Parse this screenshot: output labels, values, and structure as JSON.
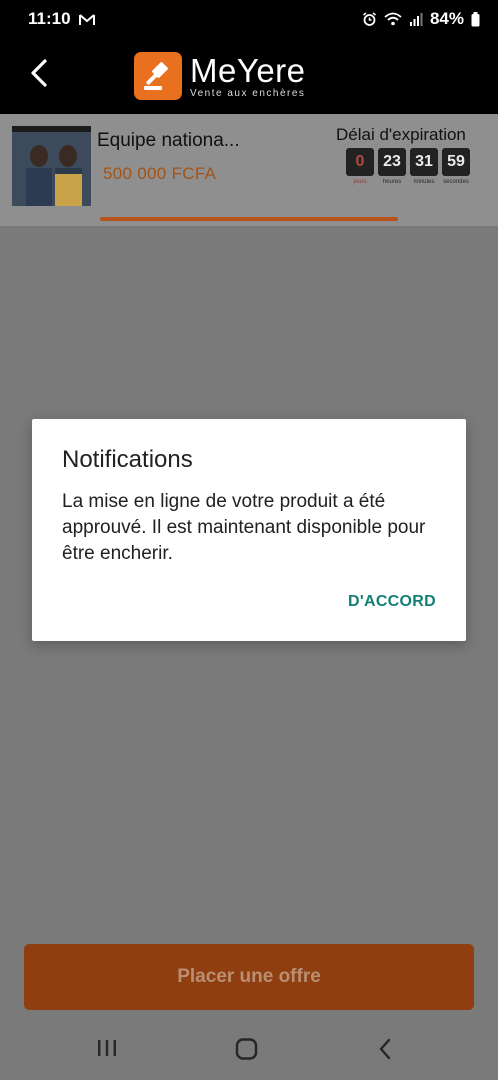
{
  "status_bar": {
    "time": "11:10",
    "battery": "84%"
  },
  "header": {
    "app_name": "MeYere",
    "tagline": "Vente aux enchères"
  },
  "product": {
    "title": "Equipe nationa...",
    "price": "500 000 FCFA",
    "expiry_label": "Délai d'expiration",
    "countdown": {
      "days": "0",
      "days_label": "jours",
      "hours": "23",
      "hours_label": "heures",
      "minutes": "31",
      "minutes_label": "minutes",
      "seconds": "59",
      "seconds_label": "secondes"
    }
  },
  "dialog": {
    "title": "Notifications",
    "message": "La mise en ligne de votre produit a été approuvé. Il est maintenant disponible pour être encherir.",
    "ok_label": "D'ACCORD"
  },
  "footer": {
    "place_offer_label": "Placer une offre"
  },
  "icons": {
    "back": "chevron-left-icon",
    "logo": "gavel-icon",
    "nav_recent": "recent-apps-icon",
    "nav_home": "home-icon",
    "nav_back": "nav-back-icon"
  },
  "colors": {
    "accent": "#e8701f",
    "dialog_action": "#138074"
  }
}
